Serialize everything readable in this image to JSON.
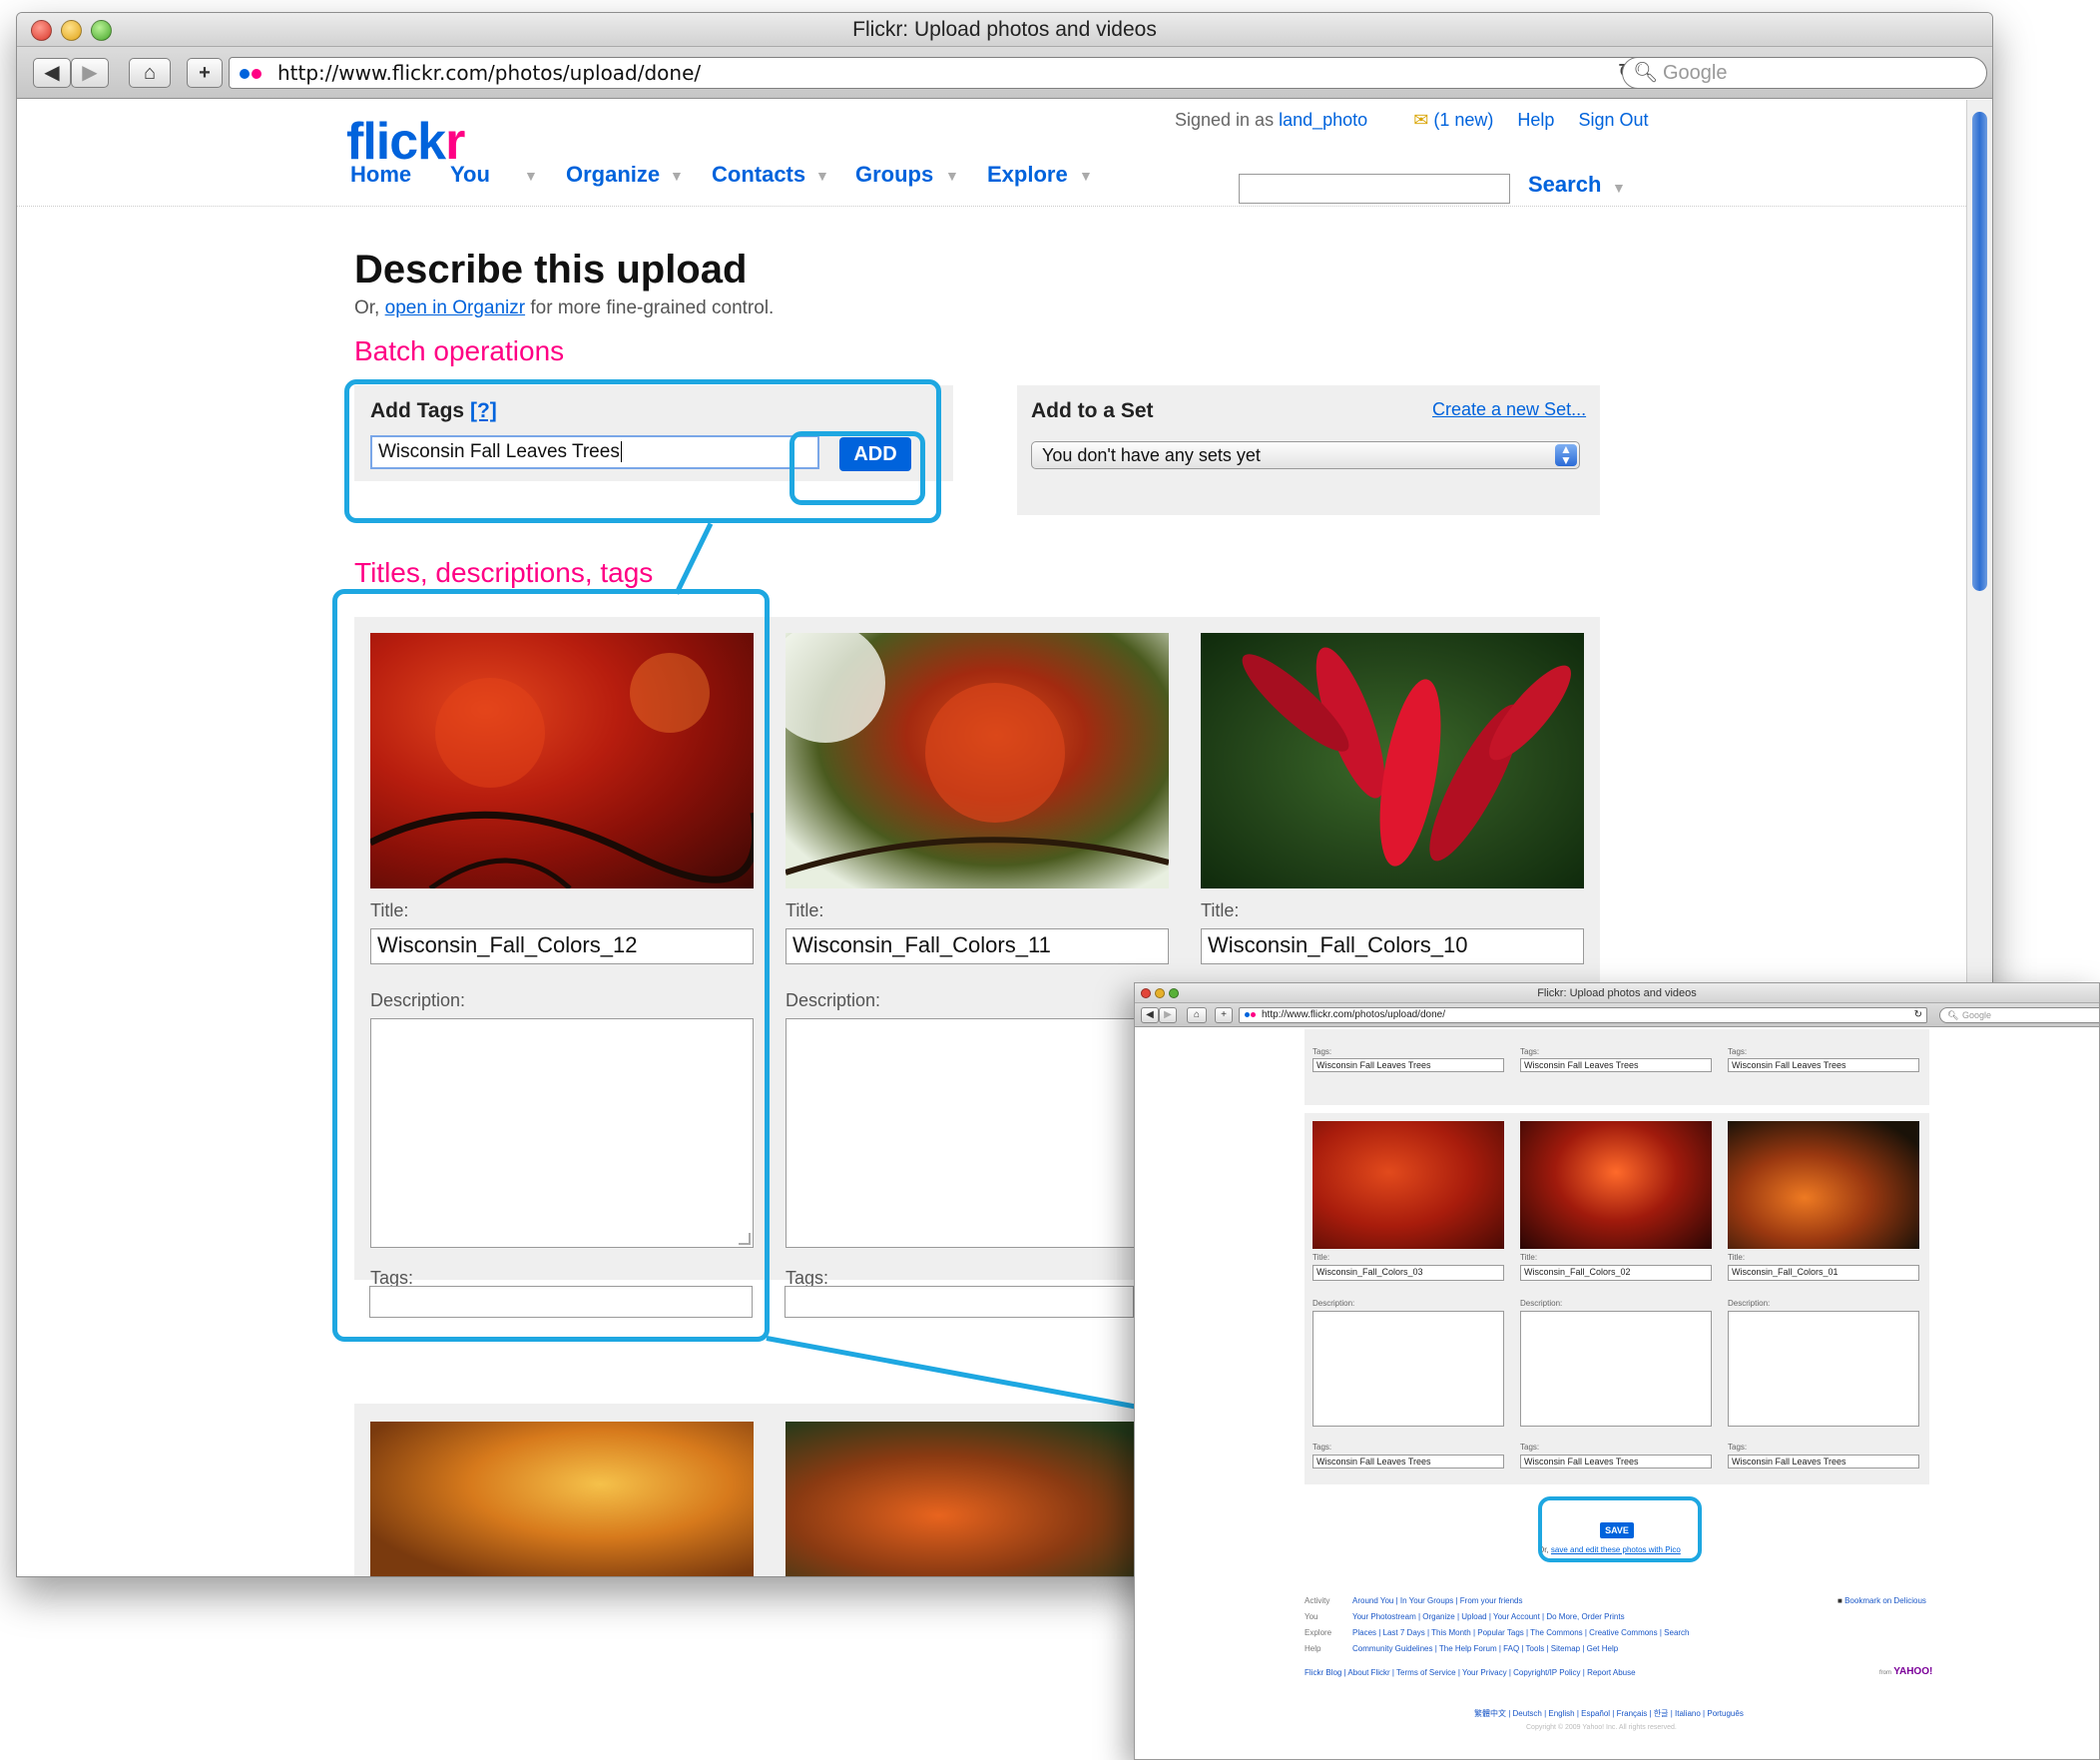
{
  "browser": {
    "window_title": "Flickr: Upload photos and videos",
    "url": "http://www.flickr.com/photos/upload/done/",
    "search_placeholder": "Google",
    "nav_back": "◀",
    "nav_forward": "▶",
    "home_icon": "⌂",
    "add_icon": "+",
    "reload_icon": "↻"
  },
  "header": {
    "logo_main": "flick",
    "logo_accent": "r",
    "signed_in_prefix": "Signed in as",
    "username": "land_photo",
    "mail_count": "(1 new)",
    "help": "Help",
    "sign_out": "Sign Out",
    "nav": [
      "Home",
      "You",
      "Organize",
      "Contacts",
      "Groups",
      "Explore"
    ],
    "search_button": "Search"
  },
  "page": {
    "title": "Describe this upload",
    "subtitle_prefix": "Or,",
    "subtitle_link": "open in Organizr",
    "subtitle_suffix": "for more fine-grained control.",
    "batch_heading": "Batch operations",
    "add_tags_label": "Add Tags",
    "add_tags_help": "[?]",
    "add_tags_value": "Wisconsin Fall Leaves Trees",
    "add_button": "ADD",
    "add_to_set_label": "Add to a Set",
    "create_set_link": "Create a new Set...",
    "set_select_value": "You don't have any sets yet",
    "titles_heading": "Titles, descriptions, tags",
    "label_title": "Title:",
    "label_description": "Description:",
    "label_tags": "Tags:",
    "photos": [
      {
        "title": "Wisconsin_Fall_Colors_12",
        "description": "",
        "tags": ""
      },
      {
        "title": "Wisconsin_Fall_Colors_11",
        "description": "",
        "tags": ""
      },
      {
        "title": "Wisconsin_Fall_Colors_10",
        "description": "",
        "tags": ""
      }
    ]
  },
  "inset": {
    "window_title": "Flickr: Upload photos and videos",
    "url": "http://www.flickr.com/photos/upload/done/",
    "search_placeholder": "Google",
    "label_tags": "Tags:",
    "label_title": "Title:",
    "label_description": "Description:",
    "top_tags": [
      "Wisconsin Fall Leaves Trees",
      "Wisconsin Fall Leaves Trees",
      "Wisconsin Fall Leaves Trees"
    ],
    "photos": [
      {
        "title": "Wisconsin_Fall_Colors_03",
        "tags": "Wisconsin Fall Leaves Trees"
      },
      {
        "title": "Wisconsin_Fall_Colors_02",
        "tags": "Wisconsin Fall Leaves Trees"
      },
      {
        "title": "Wisconsin_Fall_Colors_01",
        "tags": "Wisconsin Fall Leaves Trees"
      }
    ],
    "save_button": "SAVE",
    "save_note_prefix": "Or,",
    "save_note_link": "save and edit these photos with Pico",
    "footer": {
      "activity_key": "Activity",
      "activity": "Around You | In Your Groups | From your friends",
      "you_key": "You",
      "you": "Your Photostream | Organize | Upload | Your Account | Do More, Order Prints",
      "explore_key": "Explore",
      "explore": "Places | Last 7 Days | This Month | Popular Tags | The Commons | Creative Commons | Search",
      "help_key": "Help",
      "help": "Community Guidelines | The Help Forum | FAQ | Tools | Sitemap | Get Help",
      "links": "Flickr Blog | About Flickr | Terms of Service | Your Privacy | Copyright/IP Policy | Report Abuse",
      "bookmark": "Bookmark on Delicious",
      "from_prefix": "from",
      "yahoo": "YAHOO!",
      "languages": "繁體中文 | Deutsch | English | Español | Français | 한글 | Italiano | Português",
      "copyright": "Copyright © 2009 Yahoo! Inc. All rights reserved."
    }
  },
  "colors": {
    "flickr_blue": "#0063dc",
    "flickr_pink": "#ff0084",
    "callout": "#1ea7e1"
  }
}
